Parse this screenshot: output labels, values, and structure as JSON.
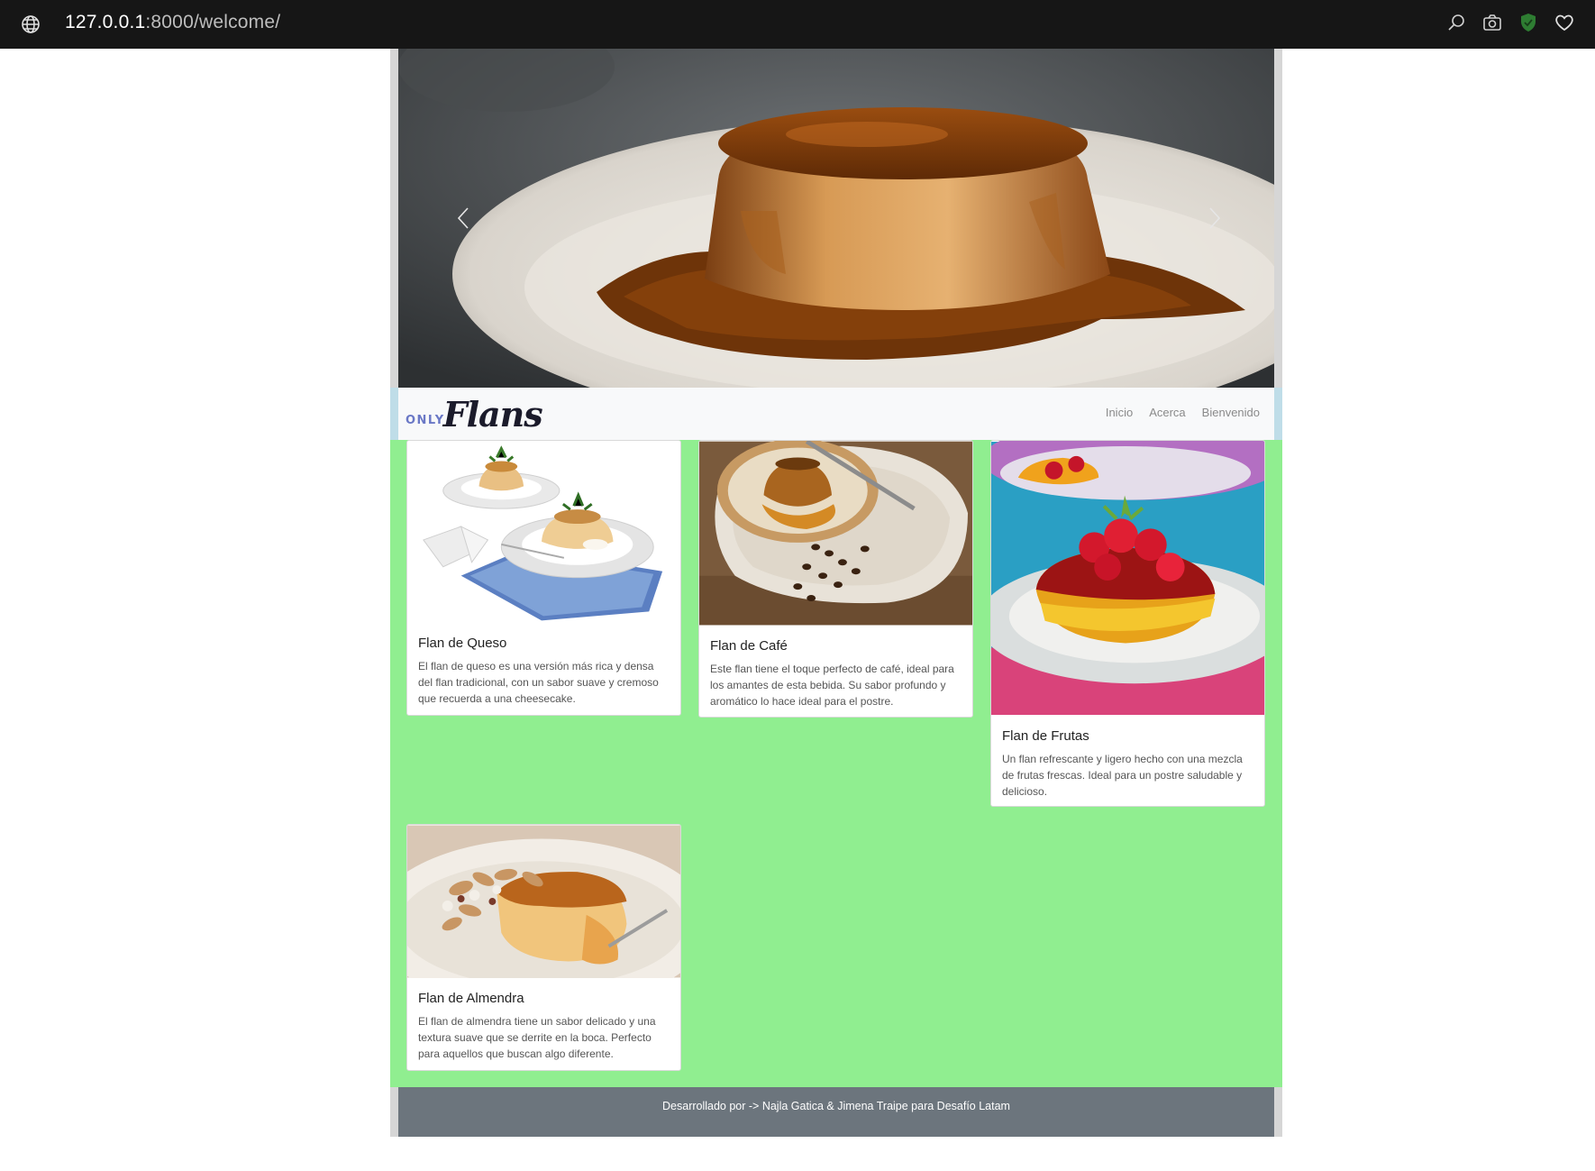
{
  "browser": {
    "url_host": "127.0.0.1",
    "url_rest": ":8000/welcome/",
    "icons": [
      "globe-icon",
      "search-icon",
      "camera-icon",
      "shield-icon",
      "heart-icon"
    ],
    "shield_color": "#2e7d32"
  },
  "navbar": {
    "brand_only": "ONLY",
    "brand_flans": "Flans",
    "links": [
      "Inicio",
      "Acerca",
      "Bienvenido"
    ]
  },
  "carousel": {
    "prev_icon": "chevron-left-icon",
    "next_icon": "chevron-right-icon"
  },
  "cards": [
    {
      "title": "Flan de Queso",
      "text": "El flan de queso es una versión más rica y densa del flan tradicional, con un sabor suave y cremoso que recuerda a una cheesecake."
    },
    {
      "title": "Flan de Café",
      "text": "Este flan tiene el toque perfecto de café, ideal para los amantes de esta bebida. Su sabor profundo y aromático lo hace ideal para el postre."
    },
    {
      "title": "Flan de Frutas",
      "text": "Un flan refrescante y ligero hecho con una mezcla de frutas frescas. Ideal para un postre saludable y delicioso."
    },
    {
      "title": "Flan de Almendra",
      "text": "El flan de almendra tiene un sabor delicado y una textura suave que se derrite en la boca. Perfecto para aquellos que buscan algo diferente."
    }
  ],
  "footer": {
    "text": "Desarrollado por -> Najla Gatica & Jimena Traipe para Desafío Latam"
  },
  "colors": {
    "content_bg": "#90ee90",
    "footer_bg": "#6c757d",
    "navbar_bg": "#f8f9fa"
  }
}
